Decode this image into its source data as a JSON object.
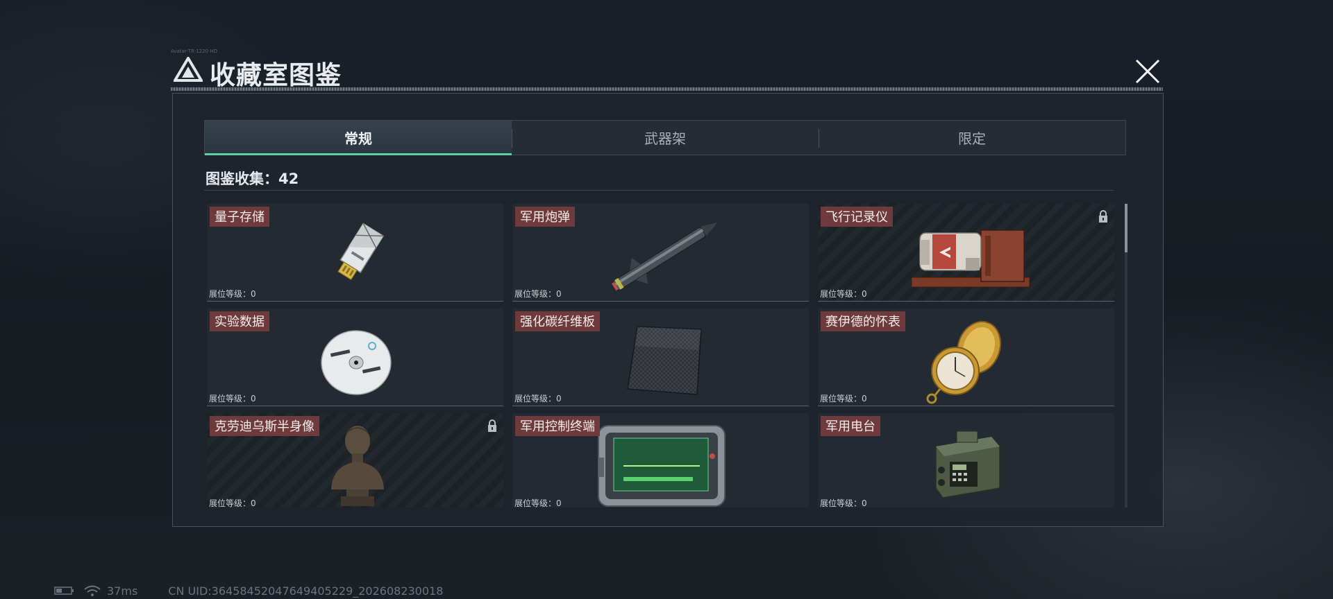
{
  "header": {
    "title": "收藏室图鉴",
    "tiny_code": "Avatar·TR·1220·HD"
  },
  "tabs": [
    {
      "label": "常规",
      "active": true
    },
    {
      "label": "武器架",
      "active": false
    },
    {
      "label": "限定",
      "active": false
    }
  ],
  "collection": {
    "label": "图鉴收集：42"
  },
  "items": [
    {
      "name": "量子存储",
      "level": "展位等级：0",
      "locked": false,
      "icon": "usb-drive-icon"
    },
    {
      "name": "军用炮弹",
      "level": "展位等级：0",
      "locked": false,
      "icon": "artillery-shell-icon"
    },
    {
      "name": "飞行记录仪",
      "level": "展位等级：0",
      "locked": true,
      "icon": "flight-recorder-icon"
    },
    {
      "name": "实验数据",
      "level": "展位等级：0",
      "locked": false,
      "icon": "disc-icon"
    },
    {
      "name": "强化碳纤维板",
      "level": "展位等级：0",
      "locked": false,
      "icon": "carbon-plate-icon"
    },
    {
      "name": "赛伊德的怀表",
      "level": "展位等级：0",
      "locked": false,
      "icon": "pocket-watch-icon"
    },
    {
      "name": "克劳迪乌斯半身像",
      "level": "展位等级：0",
      "locked": true,
      "icon": "bust-statue-icon"
    },
    {
      "name": "军用控制终端",
      "level": "展位等级：0",
      "locked": false,
      "icon": "control-terminal-icon"
    },
    {
      "name": "军用电台",
      "level": "展位等级：0",
      "locked": false,
      "icon": "military-radio-icon"
    }
  ],
  "status_bar": {
    "ping": "37ms",
    "uid": "CN UID:3645845204764940522​9_202608230018"
  },
  "colors": {
    "accent": "#5fd0a6",
    "name_badge": "#6e3a3c"
  }
}
